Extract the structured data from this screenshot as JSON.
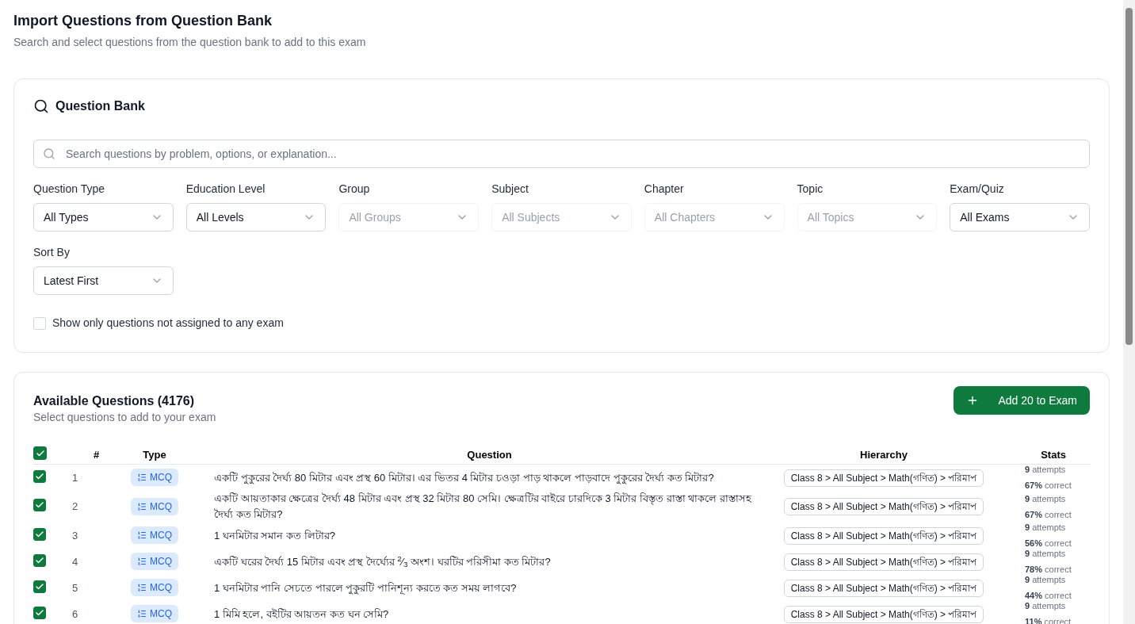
{
  "header": {
    "title": "Import Questions from Question Bank",
    "subtitle": "Search and select questions from the question bank to add to this exam"
  },
  "bank": {
    "title": "Question Bank",
    "search": {
      "placeholder": "Search questions by problem, options, or explanation..."
    },
    "filters": [
      {
        "label": "Question Type",
        "value": "All Types",
        "disabled": false
      },
      {
        "label": "Education Level",
        "value": "All Levels",
        "disabled": false
      },
      {
        "label": "Group",
        "value": "All Groups",
        "disabled": true
      },
      {
        "label": "Subject",
        "value": "All Subjects",
        "disabled": true
      },
      {
        "label": "Chapter",
        "value": "All Chapters",
        "disabled": true
      },
      {
        "label": "Topic",
        "value": "All Topics",
        "disabled": true
      },
      {
        "label": "Exam/Quiz",
        "value": "All Exams",
        "disabled": false
      },
      {
        "label": "Sort By",
        "value": "Latest First",
        "disabled": false
      }
    ],
    "unassigned_only": {
      "label": "Show only questions not assigned to any exam",
      "checked": false
    }
  },
  "questions": {
    "title": "Available Questions (4176)",
    "subtitle": "Select questions to add to your exam",
    "add_button": "Add 20 to Exam",
    "select_all_checked": true,
    "columns": [
      "#",
      "Type",
      "Question",
      "Hierarchy",
      "Stats"
    ],
    "rows": [
      {
        "checked": true,
        "number": "1",
        "type": "MCQ",
        "question": "একটি পুকুরের দৈর্ঘ্য 80 মিটার এবং প্রস্থ 60 মিটার। এর ভিতর 4 মিটার চওড়া পাড় থাকলে পাড়বাদে পুকুরের দৈর্ঘ্য কত মিটার?",
        "hierarchy": "Class 8 > All Subject > Math(গণিত) > পরিমাপ",
        "attempts": "**9** attempts",
        "correct": "**67%** correct"
      },
      {
        "checked": true,
        "number": "2",
        "type": "MCQ",
        "question": "একটি আয়তাকার ক্ষেত্রের দৈর্ঘ্য 48 মিটার এবং প্রস্থ 32 মিটার 80 সেমি। ক্ষেত্রটির বাইরে চারদিকে 3 মিটার বিস্তৃত রাস্তা থাকলে রাস্তাসহ দৈর্ঘ্য কত মিটার?",
        "hierarchy": "Class 8 > All Subject > Math(গণিত) > পরিমাপ",
        "attempts": "**9** attempts",
        "correct": "**67%** correct"
      },
      {
        "checked": true,
        "number": "3",
        "type": "MCQ",
        "question": "1 ঘনমিটার সমান কত লিটার?",
        "hierarchy": "Class 8 > All Subject > Math(গণিত) > পরিমাপ",
        "attempts": "**9** attempts",
        "correct": "**56%** correct"
      },
      {
        "checked": true,
        "number": "4",
        "type": "MCQ",
        "question": "একটি ঘরের দৈর্ঘ্য 15 মিটার এবং প্রস্থ দৈর্ঘ্যের $^{2}$⁄$_{3}$ অংশ। ঘরটির পরিসীমা কত মিটার?",
        "hierarchy": "Class 8 > All Subject > Math(গণিত) > পরিমাপ",
        "attempts": "**9** attempts",
        "correct": "**78%** correct"
      },
      {
        "checked": true,
        "number": "5",
        "type": "MCQ",
        "question": "1 ঘনমিটার পানি সেচতে পারলে পুকুরটি পানিশূন্য করতে কত সময় লাগবে?",
        "hierarchy": "Class 8 > All Subject > Math(গণিত) > পরিমাপ",
        "attempts": "**9** attempts",
        "correct": "**44%** correct"
      },
      {
        "checked": true,
        "number": "6",
        "type": "MCQ",
        "question": "1 মিমি হলে, বইটির আয়তন কত ঘন সেমি?",
        "hierarchy": "Class 8 > All Subject > Math(গণিত) > পরিমাপ",
        "attempts": "**9** attempts",
        "correct": "**11%** correct"
      }
    ]
  }
}
